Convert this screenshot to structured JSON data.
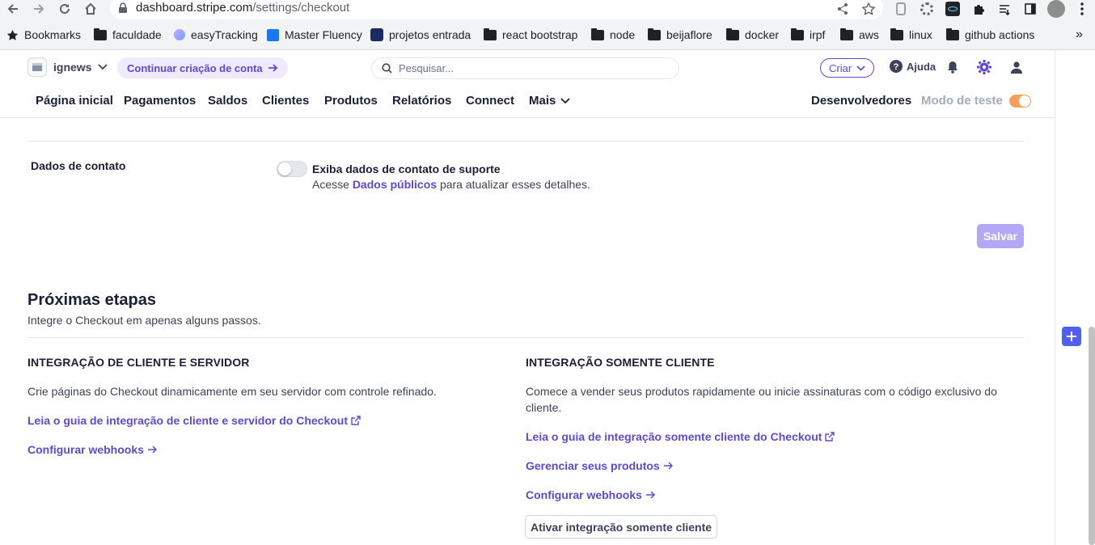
{
  "browser": {
    "url_host": "dashboard.stripe.com",
    "url_path": "/settings/checkout",
    "bookmarks": [
      {
        "label": "Bookmarks",
        "icon": "star-icon"
      },
      {
        "label": "faculdade",
        "icon": "folder-icon"
      },
      {
        "label": "easyTracking",
        "icon": "site-icon"
      },
      {
        "label": "Master Fluency",
        "icon": "site-icon"
      },
      {
        "label": "projetos entrada",
        "icon": "site-icon"
      },
      {
        "label": "react bootstrap",
        "icon": "folder-icon"
      },
      {
        "label": "node",
        "icon": "folder-icon"
      },
      {
        "label": "beijaflore",
        "icon": "folder-icon"
      },
      {
        "label": "docker",
        "icon": "folder-icon"
      },
      {
        "label": "irpf",
        "icon": "folder-icon"
      },
      {
        "label": "aws",
        "icon": "folder-icon"
      },
      {
        "label": "linux",
        "icon": "folder-icon"
      },
      {
        "label": "github actions",
        "icon": "folder-icon"
      }
    ],
    "more_label": "»"
  },
  "header": {
    "account_name": "ignews",
    "continue_label": "Continuar criação de conta",
    "search_placeholder": "Pesquisar...",
    "create_label": "Criar",
    "help_label": "Ajuda"
  },
  "nav": {
    "items": [
      "Página inicial",
      "Pagamentos",
      "Saldos",
      "Clientes",
      "Produtos",
      "Relatórios",
      "Connect",
      "Mais"
    ],
    "developers": "Desenvolvedores",
    "test_mode": "Modo de teste"
  },
  "contact": {
    "label": "Dados de contato",
    "toggle_title": "Exiba dados de contato de suporte",
    "desc_prefix": "Acesse",
    "desc_link": "Dados públicos",
    "desc_suffix": "para atualizar esses detalhes."
  },
  "save_label": "Salvar",
  "next_steps": {
    "title": "Próximas etapas",
    "subtitle": "Integre o Checkout em apenas alguns passos.",
    "left": {
      "title": "INTEGRAÇÃO DE CLIENTE E SERVIDOR",
      "text": "Crie páginas do Checkout dinamicamente em seu servidor com controle refinado.",
      "guide_link": "Leia o guia de integração de cliente e servidor do Checkout",
      "webhooks_link": "Configurar webhooks"
    },
    "right": {
      "title": "INTEGRAÇÃO SOMENTE CLIENTE",
      "text": "Comece a vender seus produtos rapidamente ou inicie assinaturas com o código exclusivo do cliente.",
      "guide_link": "Leia o guia de integração somente cliente do Checkout",
      "products_link": "Gerenciar seus produtos",
      "webhooks_link": "Configurar webhooks",
      "activate_button": "Ativar integração somente cliente"
    }
  },
  "colors": {
    "accent": "#5e48d9",
    "save_disabled": "#b4a7f5",
    "test_toggle": "#f5a05a",
    "plus_button": "#4f5ff0"
  }
}
